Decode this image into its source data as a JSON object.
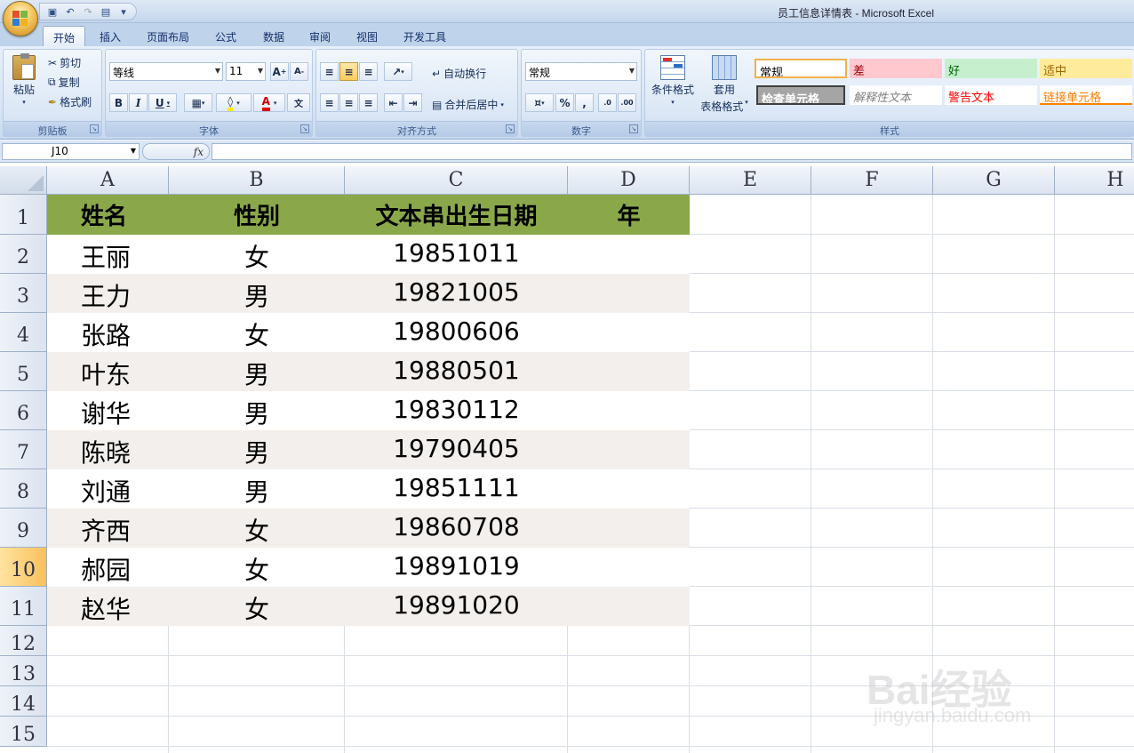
{
  "window": {
    "title": "员工信息详情表 - Microsoft Excel"
  },
  "ribbon": {
    "tabs": [
      "开始",
      "插入",
      "页面布局",
      "公式",
      "数据",
      "审阅",
      "视图",
      "开发工具"
    ],
    "active_tab": "开始",
    "clipboard": {
      "paste": "粘贴",
      "cut": "剪切",
      "copy": "复制",
      "format_painter": "格式刷",
      "label": "剪贴板"
    },
    "font": {
      "name": "等线",
      "size": "11",
      "label": "字体"
    },
    "alignment": {
      "wrap": "自动换行",
      "merge": "合并后居中",
      "label": "对齐方式"
    },
    "number": {
      "format": "常规",
      "label": "数字"
    },
    "styles": {
      "conditional": "条件格式",
      "table_format_1": "套用",
      "table_format_2": "表格格式",
      "label": "样式",
      "cells": [
        "常规",
        "差",
        "好",
        "适中",
        "检查单元格",
        "解释性文本",
        "警告文本",
        "链接单元格"
      ]
    }
  },
  "formula_bar": {
    "name_box": "J10",
    "fx": "fx",
    "value": ""
  },
  "sheet": {
    "columns": [
      "A",
      "B",
      "C",
      "D",
      "E",
      "F",
      "G",
      "H"
    ],
    "rows": [
      "1",
      "2",
      "3",
      "4",
      "5",
      "6",
      "7",
      "8",
      "9",
      "10",
      "11",
      "12",
      "13",
      "14",
      "15"
    ],
    "active_row": "10",
    "header": [
      "姓名",
      "性别",
      "文本串出生日期",
      "年"
    ],
    "data": [
      [
        "王丽",
        "女",
        "19851011",
        ""
      ],
      [
        "王力",
        "男",
        "19821005",
        ""
      ],
      [
        "张路",
        "女",
        "19800606",
        ""
      ],
      [
        "叶东",
        "男",
        "19880501",
        ""
      ],
      [
        "谢华",
        "男",
        "19830112",
        ""
      ],
      [
        "陈晓",
        "男",
        "19790405",
        ""
      ],
      [
        "刘通",
        "男",
        "19851111",
        ""
      ],
      [
        "齐西",
        "女",
        "19860708",
        ""
      ],
      [
        "郝园",
        "女",
        "19891019",
        ""
      ],
      [
        "赵华",
        "女",
        "19891020",
        ""
      ]
    ],
    "colors": {
      "header_fill": "#8aa84a",
      "band_fill": "#f2efec"
    }
  },
  "watermark": {
    "text": "Bai经验",
    "url": "jingyan.baidu.com"
  }
}
